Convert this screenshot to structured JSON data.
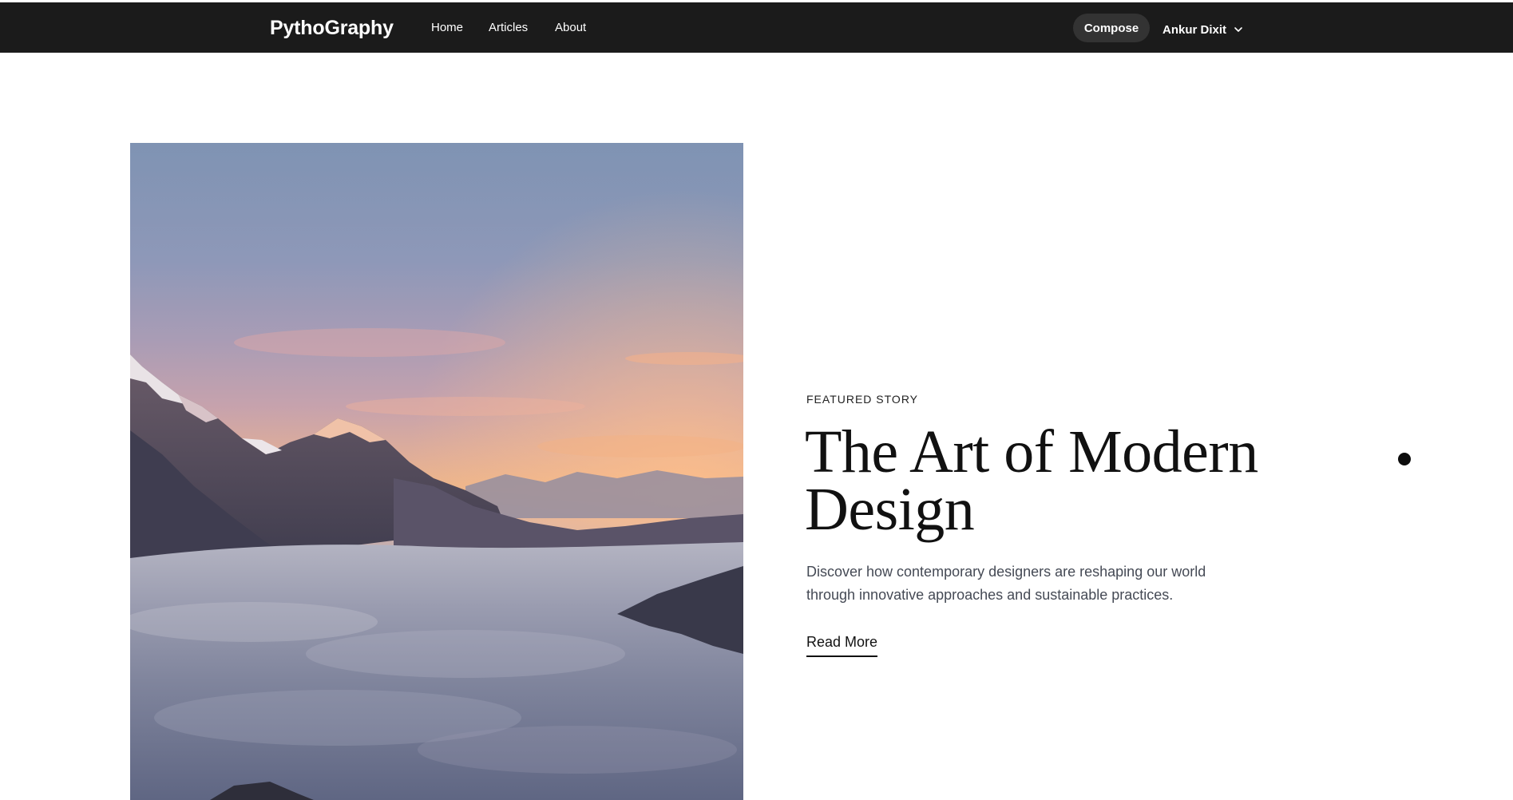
{
  "navbar": {
    "brand": "PythoGraphy",
    "links": [
      "Home",
      "Articles",
      "About"
    ],
    "compose_label": "Compose",
    "user_name": "Ankur Dixit",
    "background": "#1b1b1b"
  },
  "featured": {
    "eyebrow": "FEATURED STORY",
    "title_line1": "The Art of Modern",
    "title_line2": "Design",
    "description_line1": "Discover how contemporary designers are reshaping our world",
    "description_line2": "through innovative approaches and sustainable practices.",
    "cta_label": "Read More"
  },
  "icons": {
    "user_menu": "chevron-down-icon",
    "carousel_indicator": "dot-indicator"
  }
}
